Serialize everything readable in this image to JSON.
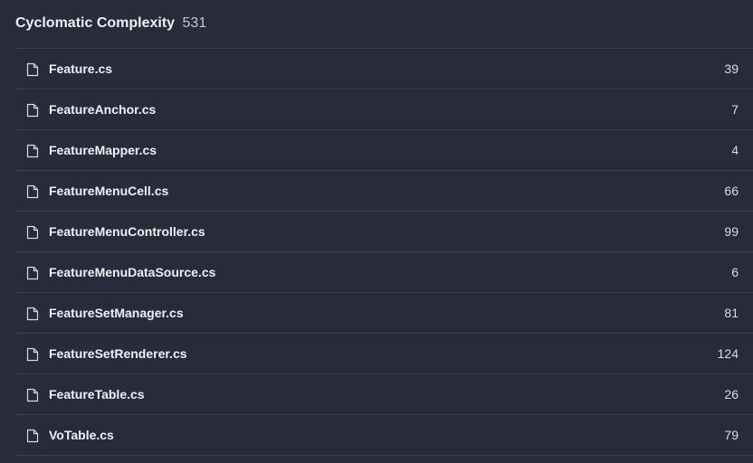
{
  "header": {
    "title": "Cyclomatic Complexity",
    "total": "531"
  },
  "files": [
    {
      "name": "Feature.cs",
      "value": "39",
      "icon": "file-icon"
    },
    {
      "name": "FeatureAnchor.cs",
      "value": "7",
      "icon": "file-icon"
    },
    {
      "name": "FeatureMapper.cs",
      "value": "4",
      "icon": "file-icon"
    },
    {
      "name": "FeatureMenuCell.cs",
      "value": "66",
      "icon": "file-icon"
    },
    {
      "name": "FeatureMenuController.cs",
      "value": "99",
      "icon": "file-icon"
    },
    {
      "name": "FeatureMenuDataSource.cs",
      "value": "6",
      "icon": "file-icon"
    },
    {
      "name": "FeatureSetManager.cs",
      "value": "81",
      "icon": "file-icon"
    },
    {
      "name": "FeatureSetRenderer.cs",
      "value": "124",
      "icon": "file-icon"
    },
    {
      "name": "FeatureTable.cs",
      "value": "26",
      "icon": "file-icon"
    },
    {
      "name": "VoTable.cs",
      "value": "79",
      "icon": "file-icon"
    }
  ],
  "colors": {
    "background": "#272b3a",
    "divider": "#3b4052",
    "text": "#eef0f5"
  }
}
